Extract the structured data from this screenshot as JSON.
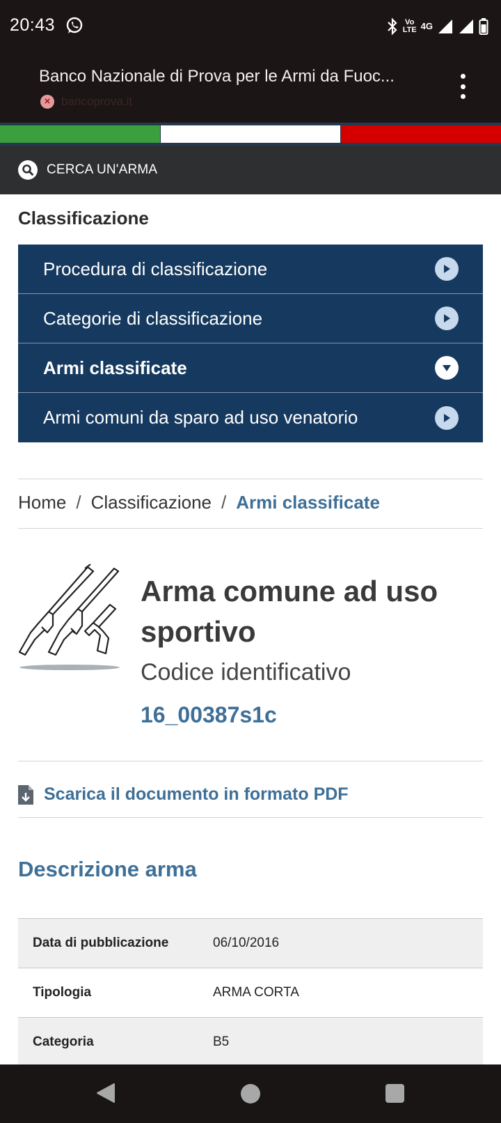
{
  "status": {
    "time": "20:43",
    "volte_top": "Vo",
    "volte_bottom": "LTE",
    "network": "4G"
  },
  "browser": {
    "title": "Banco Nazionale di Prova per le Armi da Fuoc...",
    "url": "bancoprova.it"
  },
  "search": {
    "label": "CERCA UN'ARMA"
  },
  "section": {
    "title": "Classificazione"
  },
  "menu": {
    "items": [
      {
        "label": "Procedura di classificazione",
        "state": "collapsed"
      },
      {
        "label": "Categorie di classificazione",
        "state": "collapsed"
      },
      {
        "label": "Armi classificate",
        "state": "expanded"
      },
      {
        "label": "Armi comuni da sparo ad uso venatorio",
        "state": "collapsed"
      }
    ]
  },
  "breadcrumb": {
    "sep": "/",
    "items": [
      "Home",
      "Classificazione",
      "Armi classificate"
    ]
  },
  "product": {
    "title": "Arma comune ad uso sportivo",
    "code_label": "Codice identificativo",
    "code_value": "16_00387s1c",
    "icon": "firearms-icon"
  },
  "pdf": {
    "label": "Scarica il documento in formato PDF",
    "icon": "download-document-icon"
  },
  "description": {
    "title": "Descrizione arma",
    "rows": [
      {
        "key": "Data di pubblicazione",
        "value": "06/10/2016"
      },
      {
        "key": "Tipologia",
        "value": "ARMA CORTA"
      },
      {
        "key": "Categoria",
        "value": "B5"
      }
    ]
  },
  "colors": {
    "menu_bg": "#163a5f",
    "accent": "#3e6f97",
    "flag_green": "#3b9f3d",
    "flag_white": "#ffffff",
    "flag_red": "#d40000"
  }
}
